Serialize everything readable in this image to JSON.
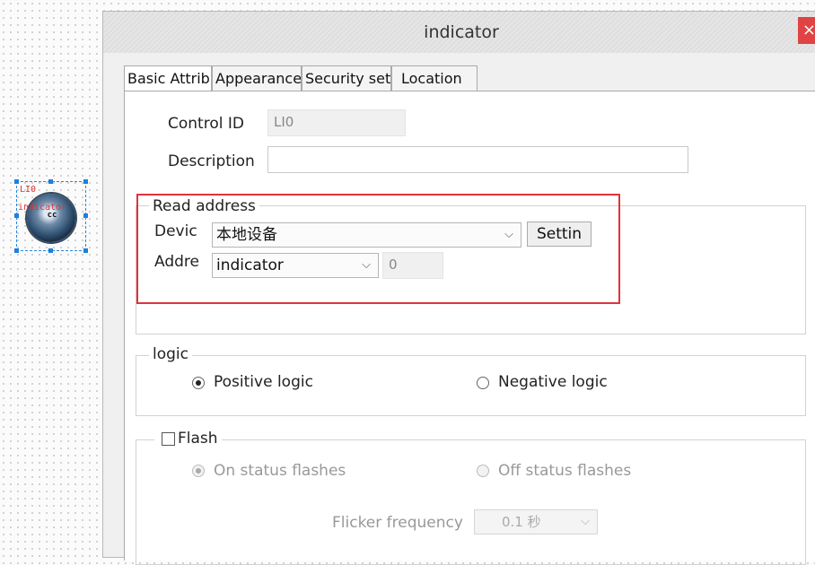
{
  "canvas": {
    "widget": {
      "id_label": "LI0",
      "name_label": "indicator",
      "center_label": "cc"
    }
  },
  "dialog": {
    "title": "indicator",
    "close": "×",
    "tabs": [
      {
        "label": "Basic Attributes"
      },
      {
        "label": "Appearance"
      },
      {
        "label": "Security set"
      },
      {
        "label": "Location"
      }
    ]
  },
  "basic": {
    "control_id_label": "Control ID",
    "control_id_value": "LI0",
    "description_label": "Description",
    "description_value": ""
  },
  "read_address": {
    "legend": "Read address",
    "device_label": "Devic",
    "device_value": "本地设备",
    "settings_button": "Settin",
    "address_label": "Addre",
    "address_value": "indicator",
    "address_offset": "0"
  },
  "logic": {
    "legend": "logic",
    "positive": "Positive logic",
    "negative": "Negative logic",
    "selected": "positive"
  },
  "flash": {
    "legend": "Flash",
    "checked": false,
    "on_status": "On status flashes",
    "off_status": "Off status flashes",
    "frequency_label": "Flicker frequency",
    "frequency_value": "0.1 秒"
  },
  "colors": {
    "highlight_border": "#e2323c",
    "close_button": "#e04343",
    "selection": "#1d7fe0"
  }
}
